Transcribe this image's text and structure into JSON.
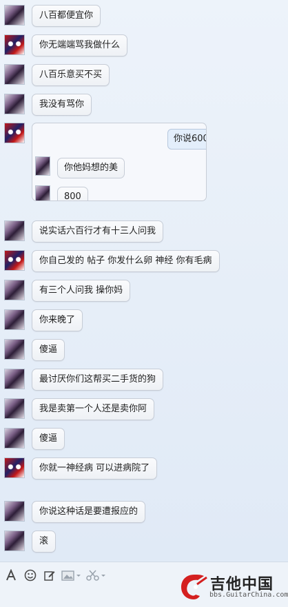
{
  "messages": [
    {
      "avatar": "person-avatar",
      "text": "八百都便宜你"
    },
    {
      "avatar": "opera-mask-avatar",
      "text": "你无端端骂我做什么"
    },
    {
      "avatar": "person-avatar",
      "text": "八百乐意买不买"
    },
    {
      "avatar": "person-avatar",
      "text": "我没有骂你"
    },
    {
      "avatar": "opera-mask-avatar",
      "text": ""
    },
    {
      "avatar": "person-avatar",
      "text": "说实话六百行才有十三人问我"
    },
    {
      "avatar": "opera-mask-avatar",
      "text": "你自己发的 帖子  你发什么卵 神经  你有毛病"
    },
    {
      "avatar": "person-avatar",
      "text": "有三个人问我 操你妈"
    },
    {
      "avatar": "person-avatar",
      "text": "你来晚了"
    },
    {
      "avatar": "person-avatar",
      "text": "傻逼"
    },
    {
      "avatar": "person-avatar",
      "text": "最讨厌你们这帮买二手货的狗"
    },
    {
      "avatar": "person-avatar",
      "text": "我是卖第一个人还是卖你阿"
    },
    {
      "avatar": "person-avatar",
      "text": "傻逼"
    },
    {
      "avatar": "opera-mask-avatar",
      "text": "你就一神经病 可以进病院了"
    },
    {
      "avatar": "person-avatar",
      "text": "你说这种话是要遭报应的"
    },
    {
      "avatar": "person-avatar",
      "text": "滚"
    }
  ],
  "quoted": {
    "right_text": "你说600",
    "left1_text": "你他妈想的美",
    "left2_text": "800"
  },
  "toolbar": {
    "icons": [
      "font-icon",
      "emoji-icon",
      "edit-icon",
      "image-icon",
      "scissors-icon"
    ]
  },
  "watermark": {
    "title": "吉他中国",
    "subtitle": "bbs.GuitarChina.com"
  }
}
